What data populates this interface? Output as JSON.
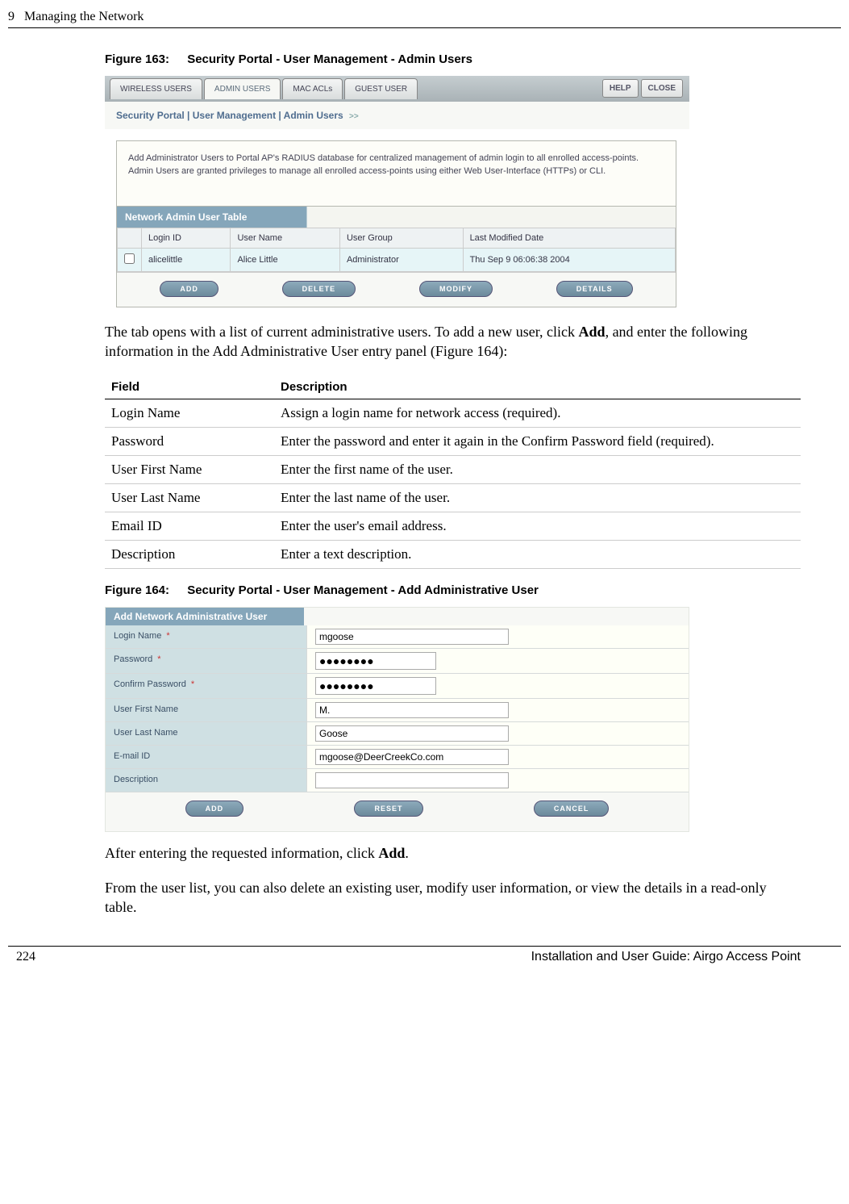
{
  "header": {
    "chapter": "9",
    "chapter_title": "Managing the Network"
  },
  "fig163": {
    "caption_num": "Figure 163:",
    "caption_text": "Security Portal - User Management - Admin Users",
    "tabs": {
      "wireless": "WIRELESS USERS",
      "admin": "ADMIN USERS",
      "mac": "MAC ACLs",
      "guest": "GUEST USER"
    },
    "help": "HELP",
    "close": "CLOSE",
    "breadcrumb": "Security Portal | User Management | Admin Users",
    "info": "Add Administrator Users to Portal AP's RADIUS database for centralized management of admin login to all enrolled access-points. Admin Users are granted privileges to manage all enrolled access-points using either Web User-Interface (HTTPs) or CLI.",
    "panel_title": "Network Admin User Table",
    "table_headers": {
      "login": "Login ID",
      "name": "User Name",
      "group": "User Group",
      "date": "Last Modified Date"
    },
    "row": {
      "login": "alicelittle",
      "name": "Alice Little",
      "group": "Administrator",
      "date": "Thu Sep 9 06:06:38 2004"
    },
    "buttons": {
      "add": "ADD",
      "delete": "DELETE",
      "modify": "MODIFY",
      "details": "DETAILS"
    }
  },
  "para1_a": "The tab opens with a list of current administrative users. To add a new user, click ",
  "para1_b": "Add",
  "para1_c": ", and enter the following information in the Add Administrative User entry panel (Figure 164):",
  "field_headers": {
    "field": "Field",
    "desc": "Description"
  },
  "fields": {
    "r1f": "Login Name",
    "r1d": "Assign a login name for network access (required).",
    "r2f": "Password",
    "r2d": "Enter the password and enter it again in the Confirm Password field (required).",
    "r3f": "User First Name",
    "r3d": "Enter the first name of the user.",
    "r4f": "User Last Name",
    "r4d": "Enter the last name of the user.",
    "r5f": "Email ID",
    "r5d": "Enter the user's email address.",
    "r6f": "Description",
    "r6d": "Enter a text description."
  },
  "fig164": {
    "caption_num": "Figure 164:",
    "caption_text": "Security Portal - User Management - Add Administrative User",
    "form_title": "Add Network Administrative User",
    "labels": {
      "login": "Login Name",
      "password": "Password",
      "confirm": "Confirm Password",
      "first": "User First Name",
      "last": "User Last Name",
      "email": "E-mail ID",
      "desc": "Description"
    },
    "req": "*",
    "values": {
      "login": "mgoose",
      "password": "●●●●●●●●",
      "confirm": "●●●●●●●●",
      "first": "M.",
      "last": "Goose",
      "email": "mgoose@DeerCreekCo.com",
      "desc": ""
    },
    "buttons": {
      "add": "ADD",
      "reset": "RESET",
      "cancel": "CANCEL"
    }
  },
  "para2_a": "After entering the requested information, click ",
  "para2_b": "Add",
  "para2_c": ".",
  "para3": "From the user list, you can also delete an existing user, modify user information, or view the details in a read-only table.",
  "footer": {
    "page": "224",
    "title": "Installation and User Guide: Airgo Access Point"
  }
}
